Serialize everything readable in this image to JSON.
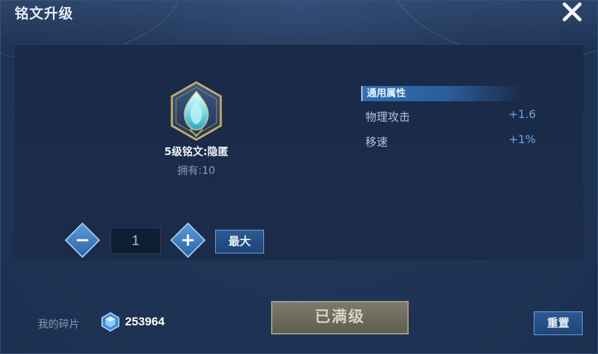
{
  "dialog": {
    "title": "铭文升级"
  },
  "rune": {
    "name": "5级铭文:隐匿",
    "owned": "拥有:10",
    "icon": "rune-flame-icon"
  },
  "attributes": {
    "header": "通用属性",
    "rows": [
      {
        "label": "物理攻击",
        "value": "+1.6"
      },
      {
        "label": "移速",
        "value": "+1%"
      }
    ]
  },
  "quantity": {
    "value": "1",
    "minus_icon": "minus-icon",
    "plus_icon": "plus-icon",
    "max_label": "最大"
  },
  "footer": {
    "shard_label": "我的碎片",
    "shard_count": "253964",
    "maxed_label": "已满级",
    "reset_label": "重置"
  },
  "colors": {
    "accent": "#2f6fb8",
    "value_blue": "#6fa4e0",
    "maxed_gray": "#6e6c60"
  }
}
